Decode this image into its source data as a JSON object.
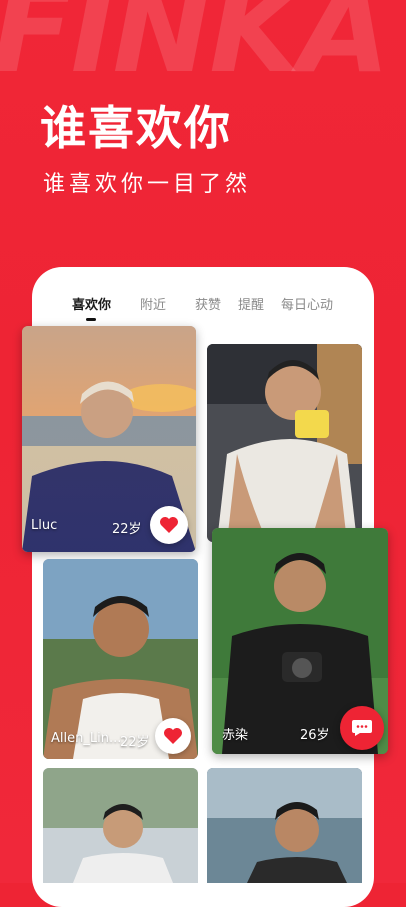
{
  "brand": {
    "watermark": "FINKA"
  },
  "hero": {
    "title": "谁喜欢你",
    "subtitle": "谁喜欢你一目了然"
  },
  "tabs": [
    {
      "label": "喜欢你",
      "active": true
    },
    {
      "label": "附近",
      "active": false
    },
    {
      "label": "获赞",
      "active": false
    },
    {
      "label": "提醒",
      "active": false
    },
    {
      "label": "每日心动",
      "active": false
    }
  ],
  "cards": [
    {
      "name": "Lluc",
      "age": "22岁",
      "action": "heart-icon"
    },
    {
      "name": "",
      "age": "",
      "action": ""
    },
    {
      "name": "Allen_Lin...",
      "age": "22岁",
      "action": "heart-icon"
    },
    {
      "name": "赤染",
      "age": "26岁",
      "action": "message-icon"
    },
    {
      "name": "",
      "age": "",
      "action": ""
    },
    {
      "name": "",
      "age": "",
      "action": ""
    }
  ],
  "colors": {
    "accent": "#ee2434",
    "card_bg": "#ffffff"
  }
}
